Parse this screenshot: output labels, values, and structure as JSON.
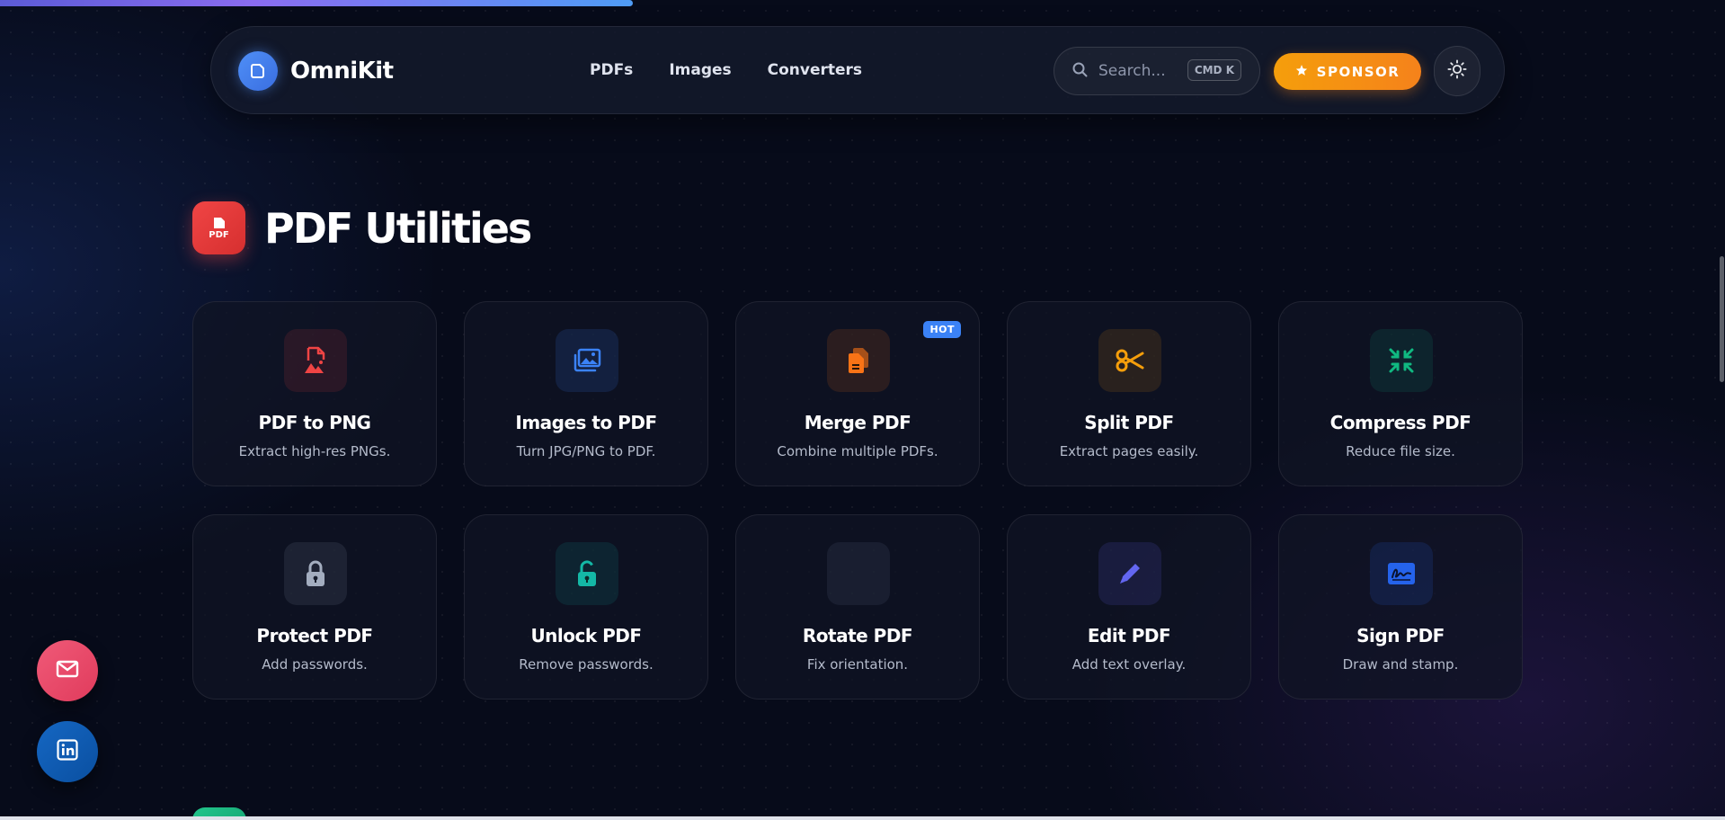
{
  "brand": {
    "name": "OmniKit"
  },
  "nav": {
    "links": [
      "PDFs",
      "Images",
      "Converters"
    ]
  },
  "search": {
    "placeholder": "Search...",
    "shortcut": "CMD K"
  },
  "sponsor": {
    "label": "SPONSOR"
  },
  "section": {
    "title": "PDF Utilities",
    "badge": "PDF"
  },
  "tools": [
    {
      "title": "PDF to PNG",
      "desc": "Extract high-res PNGs.",
      "icon": "file-image-icon",
      "color": "#ef4444"
    },
    {
      "title": "Images to PDF",
      "desc": "Turn JPG/PNG to PDF.",
      "icon": "images-icon",
      "color": "#3b82f6"
    },
    {
      "title": "Merge PDF",
      "desc": "Combine multiple PDFs.",
      "icon": "copy-files-icon",
      "color": "#f97316",
      "badge": "HOT"
    },
    {
      "title": "Split PDF",
      "desc": "Extract pages easily.",
      "icon": "scissors-icon",
      "color": "#f59e0b"
    },
    {
      "title": "Compress PDF",
      "desc": "Reduce file size.",
      "icon": "compress-icon",
      "color": "#10b981"
    },
    {
      "title": "Protect PDF",
      "desc": "Add passwords.",
      "icon": "lock-icon",
      "color": "#94a3b8"
    },
    {
      "title": "Unlock PDF",
      "desc": "Remove passwords.",
      "icon": "unlock-icon",
      "color": "#14b8a6"
    },
    {
      "title": "Rotate PDF",
      "desc": "Fix orientation.",
      "icon": "rotate-icon",
      "color": "#64748b"
    },
    {
      "title": "Edit PDF",
      "desc": "Add text overlay.",
      "icon": "pencil-icon",
      "color": "#6366f1"
    },
    {
      "title": "Sign PDF",
      "desc": "Draw and stamp.",
      "icon": "signature-icon",
      "color": "#2563eb"
    }
  ]
}
